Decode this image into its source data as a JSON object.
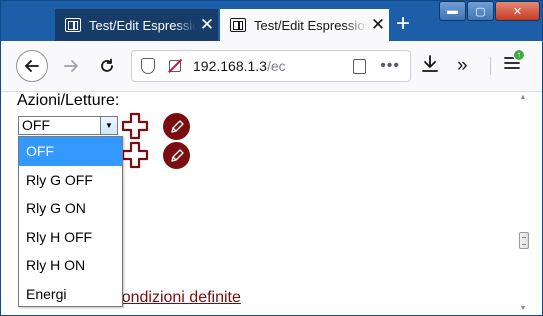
{
  "browser": {
    "tabs": [
      {
        "title": "Test/Edit Espressioni",
        "active": false
      },
      {
        "title": "Test/Edit Espressioni",
        "active": true
      }
    ],
    "new_tab_label": "+",
    "close_tab_label": "✕",
    "window_controls": {
      "minimize": "▬",
      "maximize": "▢",
      "close": "✕"
    },
    "address": {
      "host": "192.168.1.3",
      "path": "/ec"
    },
    "icons": [
      "back-arrow-icon",
      "forward-arrow-icon",
      "reload-icon",
      "shield-icon",
      "insecure-lock-icon",
      "reader-view-icon",
      "more-dots-icon",
      "download-icon",
      "overflow-chevrons-icon",
      "hamburger-menu-icon",
      "update-badge-icon"
    ],
    "update_badge_color": "#3fad45",
    "tabstrip_color": "#1c5ea8"
  },
  "page": {
    "heading": "Azioni/Letture:",
    "select": {
      "current_value": "OFF",
      "options": [
        "OFF",
        "Rly G OFF",
        "Rly G ON",
        "Rly H OFF",
        "Rly H ON",
        "Energi"
      ],
      "highlighted_index": 0
    },
    "link_text": "Espressioni/Condizioni definite",
    "accent_color": "#7a0d10",
    "highlight_color": "#3399ff"
  }
}
